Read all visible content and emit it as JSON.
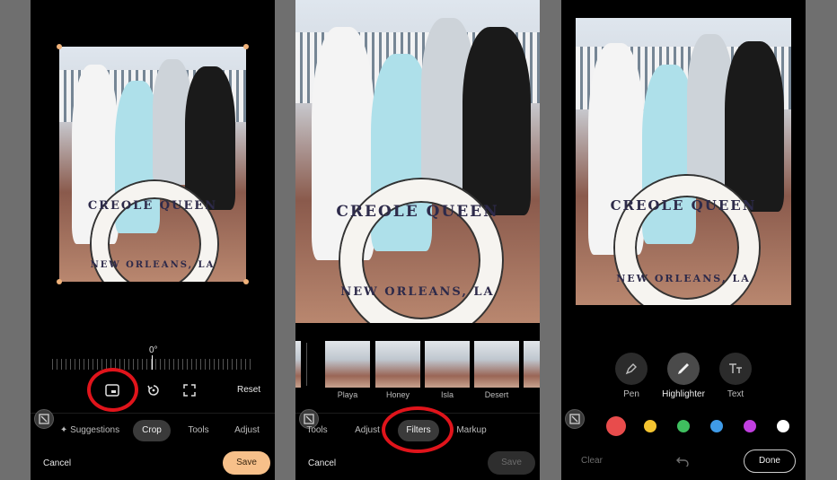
{
  "panel1": {
    "rotation": "0°",
    "reset_label": "Reset",
    "tabs": [
      "Suggestions",
      "Crop",
      "Tools",
      "Adjust"
    ],
    "active_tab": "Crop",
    "cancel_label": "Cancel",
    "save_label": "Save",
    "ring_text_top": "CREOLE QUEEN",
    "ring_text_bottom": "NEW ORLEANS, LA"
  },
  "panel2": {
    "filters": [
      "Playa",
      "Honey",
      "Isla",
      "Desert"
    ],
    "tabs": [
      "Tools",
      "Adjust",
      "Filters",
      "Markup"
    ],
    "active_tab": "Filters",
    "cancel_label": "Cancel",
    "save_label": "Save",
    "ring_text_top": "CREOLE QUEEN",
    "ring_text_bottom": "NEW ORLEANS, LA"
  },
  "panel3": {
    "tools": [
      "Pen",
      "Highlighter",
      "Text"
    ],
    "active_tool": "Highlighter",
    "colors": [
      "#e84c4c",
      "#f4c430",
      "#3fbf5f",
      "#3f9be8",
      "#c13fe0",
      "#ffffff"
    ],
    "clear_label": "Clear",
    "done_label": "Done",
    "ring_text_top": "CREOLE QUEEN",
    "ring_text_bottom": "NEW ORLEANS, LA"
  },
  "accent": {
    "save_bg": "#f7c08a",
    "highlight": "#e0141b"
  }
}
